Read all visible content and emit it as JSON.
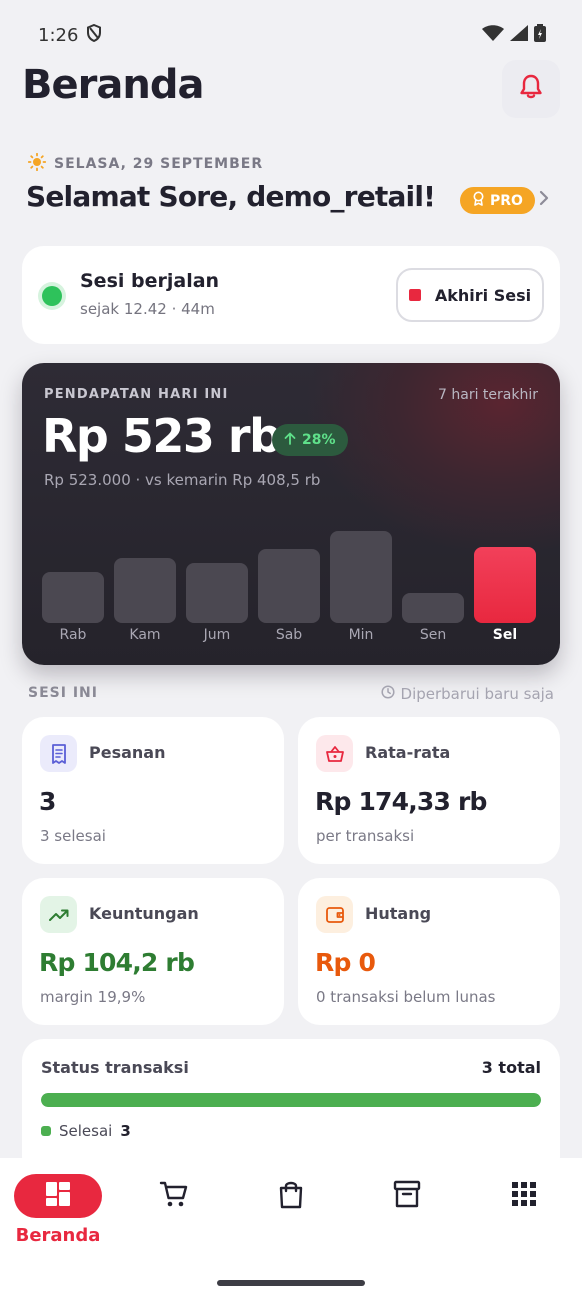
{
  "status_bar": {
    "time": "1:26"
  },
  "header": {
    "title": "Beranda"
  },
  "greeting": {
    "date": "SELASA, 29 SEPTEMBER",
    "text": "Selamat Sore, demo_retail!",
    "badge": "PRO"
  },
  "session": {
    "title": "Sesi berjalan",
    "subtitle": "sejak 12.42 · 44m",
    "end_button": "Akhiri Sesi"
  },
  "revenue": {
    "label": "PENDAPATAN HARI INI",
    "period": "7 hari terakhir",
    "amount": "Rp 523 rb",
    "change": "28%",
    "detail": "Rp 523.000 · vs kemarin Rp 408,5 rb"
  },
  "chart_data": {
    "type": "bar",
    "categories": [
      "Rab",
      "Kam",
      "Jum",
      "Sab",
      "Min",
      "Sen",
      "Sel"
    ],
    "values": [
      255,
      325,
      300,
      370,
      457,
      150,
      380
    ],
    "highlight_index": 6,
    "title": "",
    "xlabel": "",
    "ylabel": "",
    "grid": false
  },
  "section": {
    "label": "SESI INI",
    "updated": "Diperbarui baru saja"
  },
  "stats": {
    "orders": {
      "title": "Pesanan",
      "value": "3",
      "sub": "3 selesai",
      "icon": "receipt-icon",
      "color": "#5b5fd6"
    },
    "average": {
      "title": "Rata-rata",
      "value": "Rp 174,33 rb",
      "sub": "per transaksi",
      "icon": "basket-icon",
      "color": "#e8283f"
    },
    "profit": {
      "title": "Keuntungan",
      "value": "Rp 104,2 rb",
      "sub": "margin 19,9%",
      "icon": "trend-up-icon",
      "color": "#2e7d32"
    },
    "debt": {
      "title": "Hutang",
      "value": "Rp 0",
      "sub": "0 transaksi belum lunas",
      "icon": "wallet-icon",
      "color": "#e8590c"
    }
  },
  "transaction_status": {
    "title": "Status transaksi",
    "total": "3 total",
    "completed_label": "Selesai",
    "completed_count": "3",
    "completed_fraction": 1.0
  },
  "bottom_nav": {
    "active_label": "Beranda",
    "items": [
      "dashboard-icon",
      "cart-icon",
      "shopping-bag-icon",
      "archive-icon",
      "apps-grid-icon"
    ]
  },
  "colors": {
    "accent": "#e8283f",
    "success": "#4caf50",
    "warning": "#f5a524"
  }
}
